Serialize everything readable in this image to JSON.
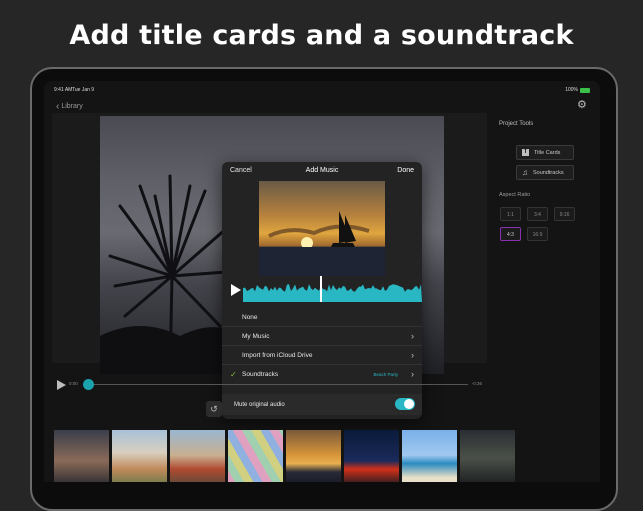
{
  "headline": "Add title cards and a soundtrack",
  "status": {
    "time": "9:41 AM",
    "date": "Tue Jan 9",
    "battery": "100%"
  },
  "nav": {
    "back_label": "Library"
  },
  "modal": {
    "cancel": "Cancel",
    "title": "Add Music",
    "done": "Done",
    "items": [
      {
        "label": "None"
      },
      {
        "label": "My Music"
      },
      {
        "label": "Import from iCloud Drive"
      },
      {
        "label": "Soundtracks",
        "value": "Beach Party",
        "checked": true
      }
    ],
    "mute_label": "Mute original audio",
    "mute_on": true
  },
  "timeline": {
    "current": "0:00",
    "total": "-0:36"
  },
  "sidebar": {
    "project_tools": "Project Tools",
    "title_cards": "Title Cards",
    "soundtracks": "Soundtracks",
    "aspect_ratio": "Aspect Ratio",
    "ratios": [
      "1:1",
      "3:4",
      "9:16",
      "4:3",
      "16:9"
    ],
    "selected_ratio": "4:3"
  },
  "colors": {
    "accent": "#2ab7c4",
    "check": "#7fbf3a",
    "ratio_selected": "#8a2fb0"
  }
}
